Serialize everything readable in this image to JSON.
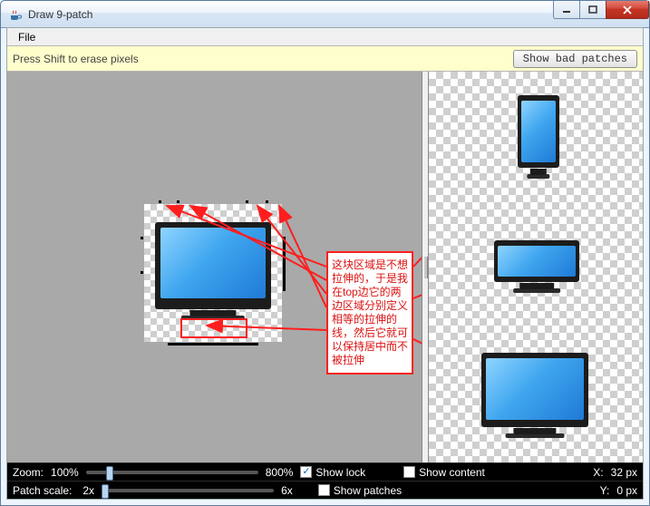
{
  "window": {
    "title": "Draw 9-patch",
    "icon": "java-cup-icon"
  },
  "menubar": {
    "file": "File"
  },
  "toolbar": {
    "help_text": "Press Shift to erase pixels",
    "show_bad_patches_label": "Show bad patches"
  },
  "annotation": {
    "text": "这块区域是不想拉伸的，于是我在top边它的两边区域分别定义相等的拉伸的线，然后它就可以保持居中而不被拉伸"
  },
  "status": {
    "zoom_label": "Zoom:",
    "zoom_min": "100%",
    "zoom_max": "800%",
    "patch_scale_label": "Patch scale:",
    "patch_scale_min": "2x",
    "patch_scale_max": "6x",
    "show_lock_label": "Show lock",
    "show_lock_checked": true,
    "show_content_label": "Show content",
    "show_content_checked": false,
    "show_patches_label": "Show patches",
    "show_patches_checked": false,
    "x_label": "X:",
    "x_value": "32 px",
    "y_label": "Y:",
    "y_value": "0 px"
  }
}
